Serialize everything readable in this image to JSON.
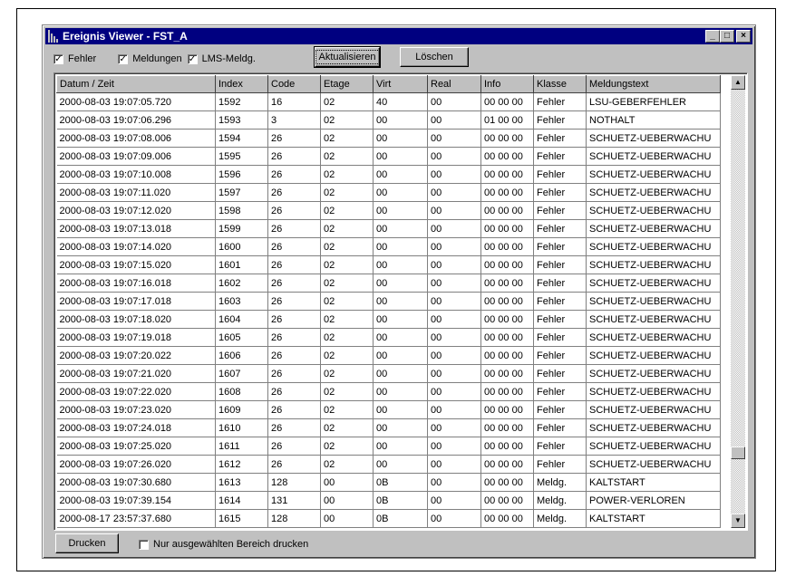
{
  "window": {
    "title": "Ereignis Viewer - FST_A"
  },
  "titlebar_buttons": {
    "minimize": "_",
    "maximize": "□",
    "close": "×"
  },
  "filters": [
    {
      "label": "Fehler",
      "checked": true,
      "mark": "✓"
    },
    {
      "label": "Meldungen",
      "checked": true,
      "mark": "✓"
    },
    {
      "label": "LMS-Meldg.",
      "checked": true,
      "mark": "✓"
    }
  ],
  "toolbar": {
    "refresh_label": "Aktualisieren",
    "delete_label": "Löschen"
  },
  "table": {
    "columns": [
      "Datum / Zeit",
      "Index",
      "Code",
      "Etage",
      "Virt",
      "Real",
      "Info",
      "Klasse",
      "Meldungstext"
    ],
    "rows": [
      [
        "2000-08-03 19:07:05.720",
        "1592",
        "16",
        "02",
        "40",
        "00",
        "00 00 00",
        "Fehler",
        "LSU-GEBERFEHLER"
      ],
      [
        "2000-08-03 19:07:06.296",
        "1593",
        "3",
        "02",
        "00",
        "00",
        "01 00 00",
        "Fehler",
        "NOTHALT"
      ],
      [
        "2000-08-03 19:07:08.006",
        "1594",
        "26",
        "02",
        "00",
        "00",
        "00 00 00",
        "Fehler",
        "SCHUETZ-UEBERWACHU"
      ],
      [
        "2000-08-03 19:07:09.006",
        "1595",
        "26",
        "02",
        "00",
        "00",
        "00 00 00",
        "Fehler",
        "SCHUETZ-UEBERWACHU"
      ],
      [
        "2000-08-03 19:07:10.008",
        "1596",
        "26",
        "02",
        "00",
        "00",
        "00 00 00",
        "Fehler",
        "SCHUETZ-UEBERWACHU"
      ],
      [
        "2000-08-03 19:07:11.020",
        "1597",
        "26",
        "02",
        "00",
        "00",
        "00 00 00",
        "Fehler",
        "SCHUETZ-UEBERWACHU"
      ],
      [
        "2000-08-03 19:07:12.020",
        "1598",
        "26",
        "02",
        "00",
        "00",
        "00 00 00",
        "Fehler",
        "SCHUETZ-UEBERWACHU"
      ],
      [
        "2000-08-03 19:07:13.018",
        "1599",
        "26",
        "02",
        "00",
        "00",
        "00 00 00",
        "Fehler",
        "SCHUETZ-UEBERWACHU"
      ],
      [
        "2000-08-03 19:07:14.020",
        "1600",
        "26",
        "02",
        "00",
        "00",
        "00 00 00",
        "Fehler",
        "SCHUETZ-UEBERWACHU"
      ],
      [
        "2000-08-03 19:07:15.020",
        "1601",
        "26",
        "02",
        "00",
        "00",
        "00 00 00",
        "Fehler",
        "SCHUETZ-UEBERWACHU"
      ],
      [
        "2000-08-03 19:07:16.018",
        "1602",
        "26",
        "02",
        "00",
        "00",
        "00 00 00",
        "Fehler",
        "SCHUETZ-UEBERWACHU"
      ],
      [
        "2000-08-03 19:07:17.018",
        "1603",
        "26",
        "02",
        "00",
        "00",
        "00 00 00",
        "Fehler",
        "SCHUETZ-UEBERWACHU"
      ],
      [
        "2000-08-03 19:07:18.020",
        "1604",
        "26",
        "02",
        "00",
        "00",
        "00 00 00",
        "Fehler",
        "SCHUETZ-UEBERWACHU"
      ],
      [
        "2000-08-03 19:07:19.018",
        "1605",
        "26",
        "02",
        "00",
        "00",
        "00 00 00",
        "Fehler",
        "SCHUETZ-UEBERWACHU"
      ],
      [
        "2000-08-03 19:07:20.022",
        "1606",
        "26",
        "02",
        "00",
        "00",
        "00 00 00",
        "Fehler",
        "SCHUETZ-UEBERWACHU"
      ],
      [
        "2000-08-03 19:07:21.020",
        "1607",
        "26",
        "02",
        "00",
        "00",
        "00 00 00",
        "Fehler",
        "SCHUETZ-UEBERWACHU"
      ],
      [
        "2000-08-03 19:07:22.020",
        "1608",
        "26",
        "02",
        "00",
        "00",
        "00 00 00",
        "Fehler",
        "SCHUETZ-UEBERWACHU"
      ],
      [
        "2000-08-03 19:07:23.020",
        "1609",
        "26",
        "02",
        "00",
        "00",
        "00 00 00",
        "Fehler",
        "SCHUETZ-UEBERWACHU"
      ],
      [
        "2000-08-03 19:07:24.018",
        "1610",
        "26",
        "02",
        "00",
        "00",
        "00 00 00",
        "Fehler",
        "SCHUETZ-UEBERWACHU"
      ],
      [
        "2000-08-03 19:07:25.020",
        "1611",
        "26",
        "02",
        "00",
        "00",
        "00 00 00",
        "Fehler",
        "SCHUETZ-UEBERWACHU"
      ],
      [
        "2000-08-03 19:07:26.020",
        "1612",
        "26",
        "02",
        "00",
        "00",
        "00 00 00",
        "Fehler",
        "SCHUETZ-UEBERWACHU"
      ],
      [
        "2000-08-03 19:07:30.680",
        "1613",
        "128",
        "00",
        "0B",
        "00",
        "00 00 00",
        "Meldg.",
        "KALTSTART"
      ],
      [
        "2000-08-03 19:07:39.154",
        "1614",
        "131",
        "00",
        "0B",
        "00",
        "00 00 00",
        "Meldg.",
        "POWER-VERLOREN"
      ],
      [
        "2000-08-17 23:57:37.680",
        "1615",
        "128",
        "00",
        "0B",
        "00",
        "00 00 00",
        "Meldg.",
        "KALTSTART"
      ]
    ]
  },
  "scrollbar": {
    "up": "▲",
    "down": "▼"
  },
  "footer": {
    "print_label": "Drucken",
    "print_selection_label": "Nur ausgewählten Bereich drucken",
    "print_selection_checked": false
  }
}
